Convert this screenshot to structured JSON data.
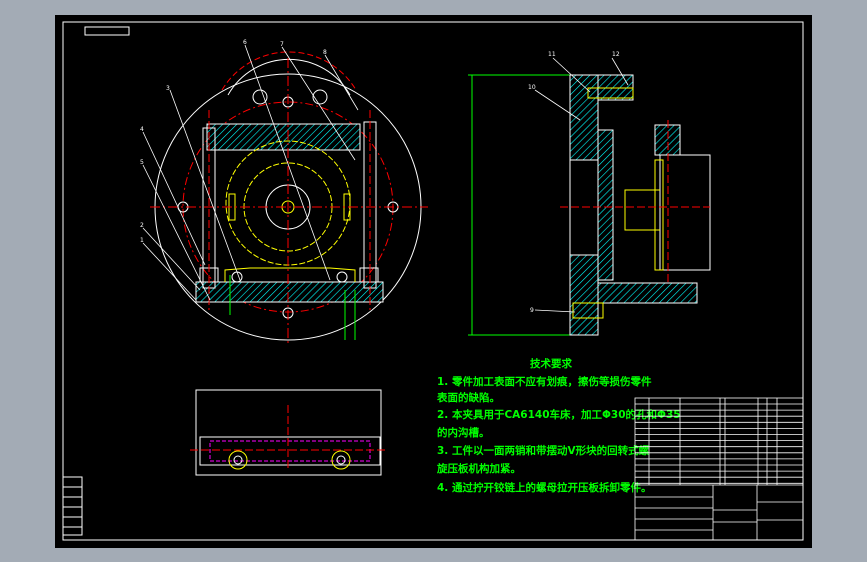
{
  "colors": {
    "background": "#000000",
    "frame": "#a3abb5",
    "outline": "#ffffff",
    "center_line": "#ff0000",
    "hidden": "#ffff00",
    "hatch": "#00ffff",
    "dimension": "#00ff00"
  },
  "tech_requirements": {
    "title": "技术要求",
    "lines": [
      "1. 零件加工表面不应有划痕，擦伤等损伤零件",
      "表面的缺陷。",
      "2. 本夹具用于CA6140车床，加工Φ30的孔和Φ35",
      "的内沟槽。",
      "3. 工件以一面两销和带摆动V形块的回转式螺",
      "旋压板机构加紧。",
      "4. 通过拧开铰链上的螺母拉开压板拆卸零件。"
    ]
  },
  "part_labels": {
    "left": [
      "3",
      "4",
      "5",
      "2",
      "1"
    ],
    "top": [
      "6",
      "7",
      "8"
    ],
    "right": [
      "11",
      "12",
      "10",
      "9"
    ]
  }
}
